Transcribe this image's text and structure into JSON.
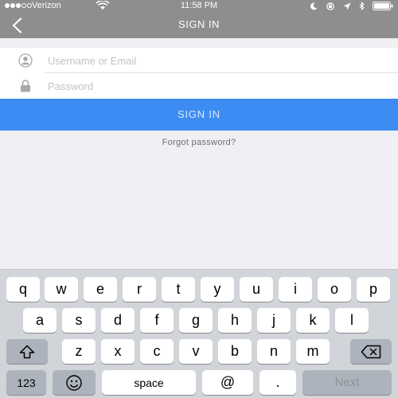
{
  "status_bar": {
    "carrier": "Verizon",
    "time": "11:58 PM",
    "icons": [
      "signal-dots",
      "wifi-icon",
      "moon-icon",
      "lock-rotation-icon",
      "location-arrow-icon",
      "bluetooth-icon",
      "battery-icon"
    ]
  },
  "nav": {
    "title": "SIGN IN",
    "back_icon": "chevron-left-icon"
  },
  "form": {
    "username": {
      "placeholder": "Username or Email",
      "value": "",
      "icon": "user-icon"
    },
    "password": {
      "placeholder": "Password",
      "value": "",
      "icon": "lock-icon"
    }
  },
  "sign_in_button": {
    "label": "SIGN IN"
  },
  "forgot_password": {
    "label": "Forgot password?"
  },
  "keyboard": {
    "row1": [
      "q",
      "w",
      "e",
      "r",
      "t",
      "y",
      "u",
      "i",
      "o",
      "p"
    ],
    "row2": [
      "a",
      "s",
      "d",
      "f",
      "g",
      "h",
      "j",
      "k",
      "l"
    ],
    "row3": [
      "z",
      "x",
      "c",
      "v",
      "b",
      "n",
      "m"
    ],
    "numbers_label": "123",
    "space_label": "space",
    "at_label": "@",
    "dot_label": ".",
    "next_label": "Next",
    "icons": [
      "shift-icon",
      "backspace-icon",
      "emoji-icon"
    ]
  },
  "colors": {
    "header": "#8e8e8e",
    "primary": "#3d8cf3",
    "background": "#efeff4",
    "keyboard": "#d1d4d9"
  }
}
